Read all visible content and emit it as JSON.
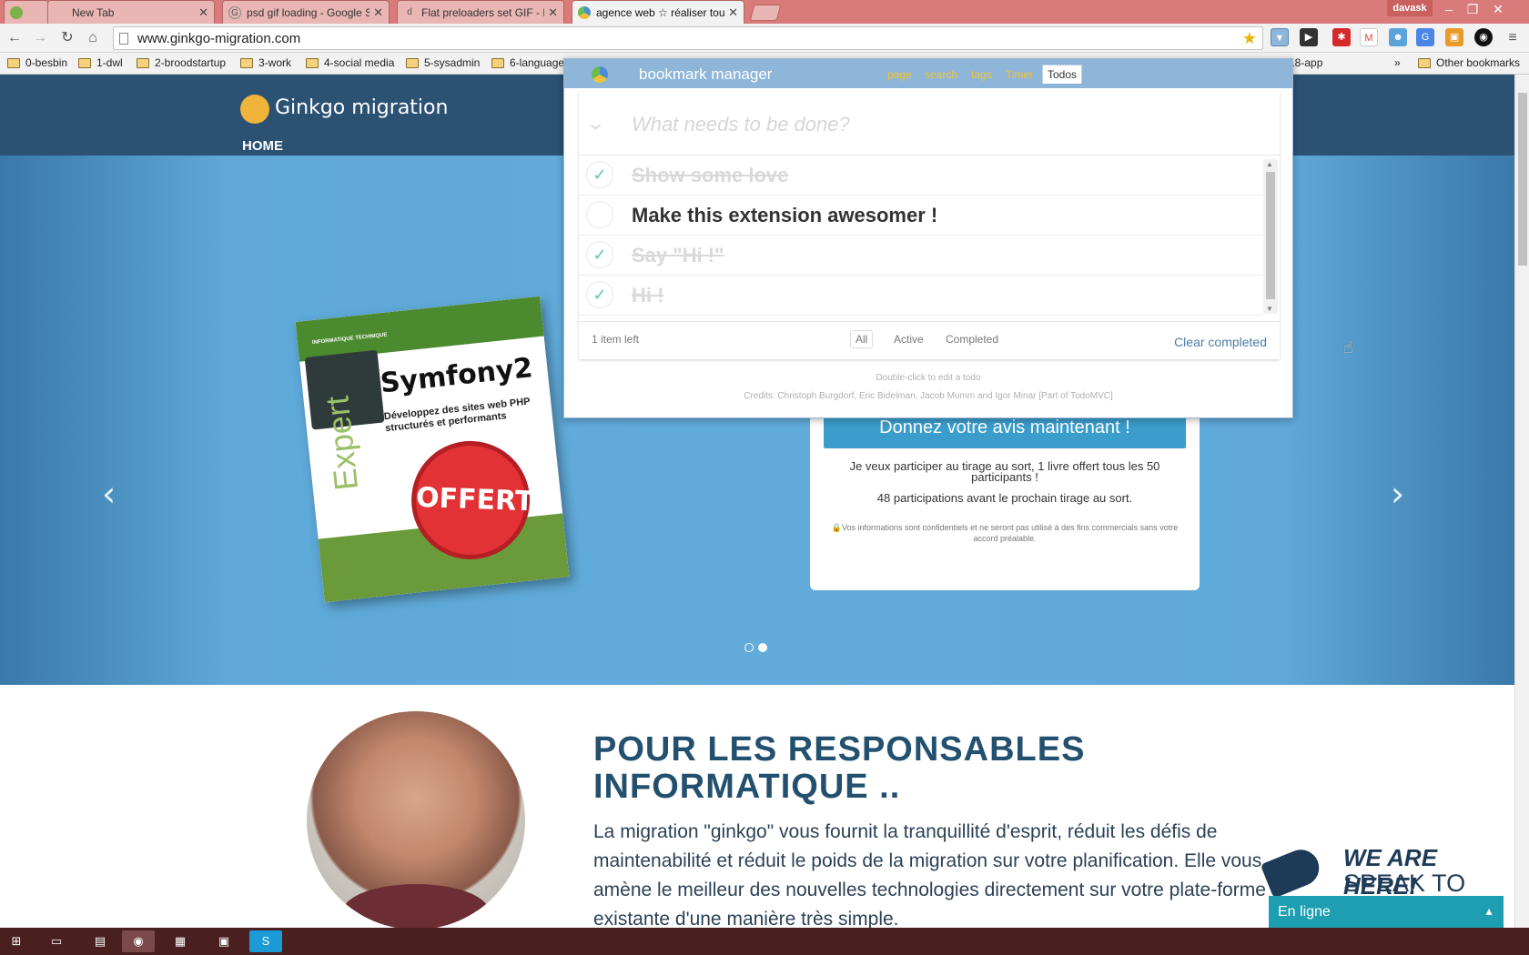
{
  "browser": {
    "tabs": [
      {
        "label": "",
        "icon": "feather-icon",
        "active": false
      },
      {
        "label": "New Tab",
        "icon": "blank-icon",
        "active": false
      },
      {
        "label": "psd gif loading - Google S",
        "icon": "google-icon",
        "active": false
      },
      {
        "label": "Flat preloaders set GIF - Fr",
        "icon": "dribbble-icon",
        "active": false
      },
      {
        "label": "agence web ☆ réaliser tou",
        "icon": "ginkgo-icon",
        "active": true
      }
    ],
    "user": "davask",
    "url": "www.ginkgo-migration.com",
    "bookmarks": [
      "0-besbin",
      "1-dwl",
      "2-broodstartup",
      "3-work",
      "4-social media",
      "5-sysadmin",
      "6-language",
      "18-app",
      "Other bookmarks"
    ],
    "overflow": "»"
  },
  "site": {
    "brand": "Ginkgo migration",
    "nav_home": "HOME",
    "book": {
      "series": "INFORMATIQUE TECHNIQUE",
      "spine": "Expert",
      "title": "Symfony2",
      "subtitle": "Développez des sites web PHP structurés et performants",
      "stamp": "OFFERT"
    },
    "cta": "Donnez votre avis maintenant !",
    "raffle_text": "Je veux participer au tirage au sort, 1 livre offert tous les 50 participants !",
    "participations_text": "48 participations avant le prochain tirage au sort.",
    "privacy_note": "Vos informations sont confidentiels et ne seront pas utilisé à des fins commercials sans votre accord préalable.",
    "section_heading": "POUR LES RESPONSABLES INFORMATIQUE ..",
    "section_body": "La migration \"ginkgo\" vous fournit la tranquillité d'esprit, réduit les défis de maintenabilité et réduit le poids de la migration sur votre planification. Elle vous amène le meilleur des nouvelles technologies directement sur votre plate-forme existante d'une manière très simple.",
    "chat_title1": "WE ARE HERE!",
    "chat_title2": "SPEAK TO US",
    "chat_status": "En ligne",
    "carousel_slide": 2,
    "carousel_total": 2
  },
  "popup": {
    "title": "bookmark manager",
    "tabs": [
      "page",
      "search",
      "tags",
      "Timer",
      "Todos"
    ],
    "active_tab": "Todos",
    "input_placeholder": "What needs to be done?",
    "todos": [
      {
        "text": "Show some love",
        "completed": true
      },
      {
        "text": "Make this extension awesomer !",
        "completed": false
      },
      {
        "text": "Say \"Hi !\"",
        "completed": true
      },
      {
        "text": "Hi !",
        "completed": true
      }
    ],
    "items_left": "1 item left",
    "filters": [
      "All",
      "Active",
      "Completed"
    ],
    "selected_filter": "All",
    "clear_completed": "Clear completed",
    "hint": "Double-click to edit a todo",
    "credits": "Credits: Christoph Burgdorf, Eric Bidelman, Jacob Mumm and Igor Minar  [Part of TodoMVC]"
  },
  "colors": {
    "titlebar": "#d87b7a",
    "header": "#2b5273",
    "hero": "#62acdb",
    "cta": "#3a9dcc",
    "heading": "#24506f",
    "chat": "#1d9fb1",
    "taskbar": "#4a1f1f"
  }
}
